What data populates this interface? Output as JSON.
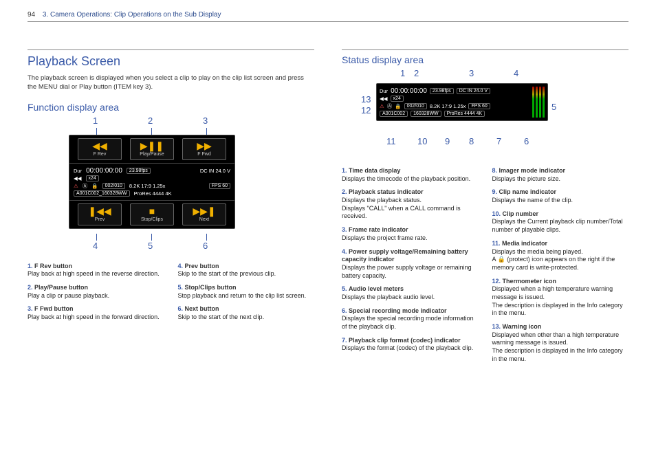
{
  "header": {
    "page_no": "94",
    "chapter": "3. Camera Operations: Clip Operations on the Sub Display"
  },
  "left": {
    "h1": "Playback Screen",
    "intro": "The playback screen is displayed when you select a clip to play on the clip list screen and press the MENU dial or Play button (ITEM key 3).",
    "h2": "Function display area",
    "top_nums": [
      "1",
      "2",
      "3"
    ],
    "bot_nums": [
      "4",
      "5",
      "6"
    ],
    "panel": {
      "top_labels": [
        "F Rev",
        "Play/Pause",
        "F Fwd"
      ],
      "bot_labels": [
        "Prev",
        "Stop/Clips",
        "Next"
      ],
      "tc_prefix": "Dur",
      "tc": "00:00:00:00",
      "fps": "23.98fps",
      "dc": "DC IN 24.0 V",
      "speed": "x24",
      "clip_counter": "002/010",
      "res": "8.2K 17:9 1.25x",
      "fpsx": "FPS 60",
      "clip_name": "A001C002_160328WW",
      "codec": "ProRes 4444 4K"
    },
    "defs_a": [
      {
        "n": "1.",
        "t": "F Rev button",
        "d": "Play back at high speed in the reverse direction."
      },
      {
        "n": "2.",
        "t": "Play/Pause button",
        "d": "Play a clip or pause playback."
      },
      {
        "n": "3.",
        "t": "F Fwd button",
        "d": "Play back at high speed in the forward direction."
      }
    ],
    "defs_b": [
      {
        "n": "4.",
        "t": "Prev button",
        "d": "Skip to the start of the previous clip."
      },
      {
        "n": "5.",
        "t": "Stop/Clips button",
        "d": "Stop playback and return to the clip list screen."
      },
      {
        "n": "6.",
        "t": "Next button",
        "d": "Skip to the start of the next clip."
      }
    ]
  },
  "right": {
    "h2": "Status display area",
    "top_nums": [
      "1",
      "2",
      "3",
      "4"
    ],
    "side": {
      "n5": "5",
      "n12": "12",
      "n13": "13"
    },
    "bot_nums": [
      "11",
      "10",
      "9",
      "8",
      "7",
      "6"
    ],
    "panel": {
      "tc_prefix": "Dur",
      "tc": "00:00:00:00",
      "fps": "23.98fps",
      "dc": "DC IN 24.0 V",
      "speed": "x24",
      "mediaA": "A",
      "clip_counter": "002/010",
      "res": "8.2K 17:9 1.25x",
      "fpsx": "FPS 60",
      "clip_name": "A001C002",
      "clip_suffix": "160328WW",
      "codec": "ProRes 4444 4K"
    },
    "defs_a": [
      {
        "n": "1.",
        "t": "Time data display",
        "d": "Displays the timecode of the playback position."
      },
      {
        "n": "2.",
        "t": "Playback status indicator",
        "d": "Displays the playback status.",
        "d2": "Displays \"CALL\" when a CALL command is received."
      },
      {
        "n": "3.",
        "t": "Frame rate indicator",
        "d": "Displays the project frame rate."
      },
      {
        "n": "4.",
        "t": "Power supply voltage/Remaining battery capacity indicator",
        "d": "Displays the power supply voltage or remaining battery capacity."
      },
      {
        "n": "5.",
        "t": "Audio level meters",
        "d": "Displays the playback audio level."
      },
      {
        "n": "6.",
        "t": "Special recording mode indicator",
        "d": "Displays the special recording mode information of the playback clip."
      },
      {
        "n": "7.",
        "t": "Playback clip format (codec) indicator",
        "d": "Displays the format (codec) of the playback clip."
      }
    ],
    "defs_b": [
      {
        "n": "8.",
        "t": "Imager mode indicator",
        "d": "Displays the picture size."
      },
      {
        "n": "9.",
        "t": "Clip name indicator",
        "d": "Displays the name of the clip."
      },
      {
        "n": "10.",
        "t": "Clip number",
        "d": "Displays the Current playback clip number/Total number of playable clips."
      },
      {
        "n": "11.",
        "t": "Media indicator",
        "d": "Displays the media being played.",
        "d2": "A 🔒 (protect) icon appears on the right if the memory card is write-protected."
      },
      {
        "n": "12.",
        "t": "Thermometer icon",
        "d": "Displayed when a high temperature warning message is issued.",
        "d2": "The description is displayed in the Info category in the menu."
      },
      {
        "n": "13.",
        "t": "Warning icon",
        "d": "Displayed when other than a high temperature warning message is issued.",
        "d2": "The description is displayed in the Info category in the menu."
      }
    ]
  }
}
